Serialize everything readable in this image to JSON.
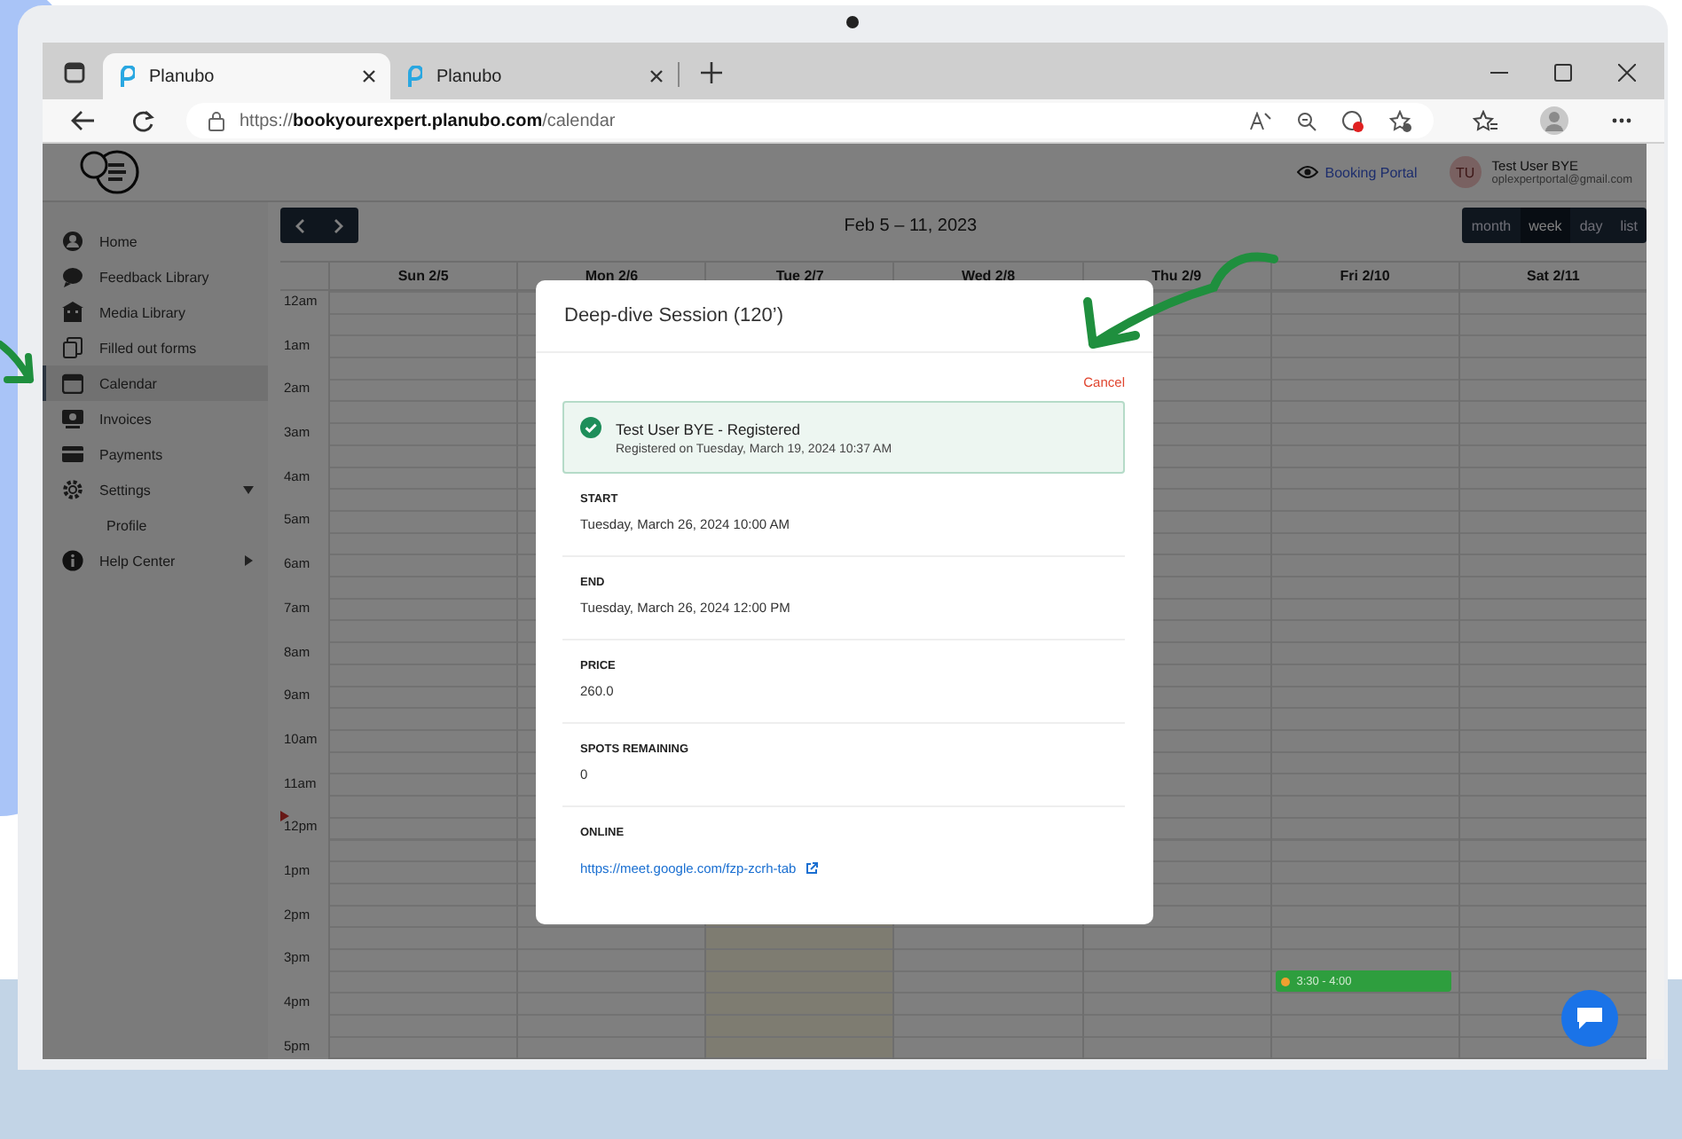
{
  "browser": {
    "tabs": [
      {
        "title": "Planubo",
        "selected": true
      },
      {
        "title": "Planubo",
        "selected": false
      }
    ],
    "url": {
      "scheme": "https://",
      "host": "bookyourexpert.planubo.com",
      "path": "/calendar"
    }
  },
  "header": {
    "booking_portal": "Booking Portal",
    "user": {
      "initials": "TU",
      "name": "Test User BYE",
      "email": "oplexpertportal@gmail.com"
    }
  },
  "sidebar": {
    "items": [
      {
        "label": "Home",
        "kind": "user",
        "selected": false
      },
      {
        "label": "Feedback Library",
        "kind": "chat",
        "selected": false
      },
      {
        "label": "Media Library",
        "kind": "building",
        "selected": false
      },
      {
        "label": "Filled out forms",
        "kind": "forms",
        "selected": false
      },
      {
        "label": "Calendar",
        "kind": "calendar",
        "selected": true
      },
      {
        "label": "Invoices",
        "kind": "invoice",
        "selected": false
      },
      {
        "label": "Payments",
        "kind": "card",
        "selected": false
      },
      {
        "label": "Settings",
        "kind": "gear",
        "selected": false,
        "expanded": true,
        "children": [
          {
            "label": "Profile"
          }
        ]
      },
      {
        "label": "Help Center",
        "kind": "info",
        "selected": false,
        "expanded": false
      }
    ]
  },
  "calendar": {
    "range": "Feb 5 – 11, 2023",
    "views": [
      {
        "label": "month",
        "selected": false
      },
      {
        "label": "week",
        "selected": true
      },
      {
        "label": "day",
        "selected": false
      },
      {
        "label": "list",
        "selected": false
      }
    ],
    "days": [
      {
        "label": "Sun 2/5",
        "today": false
      },
      {
        "label": "Mon 2/6",
        "today": false
      },
      {
        "label": "Tue 2/7",
        "today": true
      },
      {
        "label": "Wed 2/8",
        "today": false
      },
      {
        "label": "Thu 2/9",
        "today": false
      },
      {
        "label": "Fri 2/10",
        "today": false,
        "events": [
          {
            "time": "3:30 - 4:00",
            "color": "#2e9e3e"
          }
        ]
      },
      {
        "label": "Sat 2/11",
        "today": false
      }
    ],
    "times": [
      "12am",
      "1am",
      "2am",
      "3am",
      "4am",
      "5am",
      "6am",
      "7am",
      "8am",
      "9am",
      "10am",
      "11am",
      "12pm",
      "1pm",
      "2pm",
      "3pm",
      "4pm",
      "5pm"
    ]
  },
  "modal": {
    "title": "Deep-dive Session (120’)",
    "cancel": "Cancel",
    "registration": {
      "name": "Test User BYE - Registered",
      "detail": "Registered on Tuesday, March 19, 2024 10:37 AM"
    },
    "fields": [
      {
        "label": "START",
        "value": "Tuesday, March 26, 2024 10:00 AM",
        "kind": "text"
      },
      {
        "label": "END",
        "value": "Tuesday, March 26, 2024 12:00 PM",
        "kind": "text"
      },
      {
        "label": "PRICE",
        "value": "260.0",
        "kind": "text"
      },
      {
        "label": "SPOTS REMAINING",
        "value": "0",
        "kind": "text"
      },
      {
        "label": "ONLINE",
        "value": "https://meet.google.com/fzp-zcrh-tab",
        "kind": "link"
      }
    ]
  }
}
